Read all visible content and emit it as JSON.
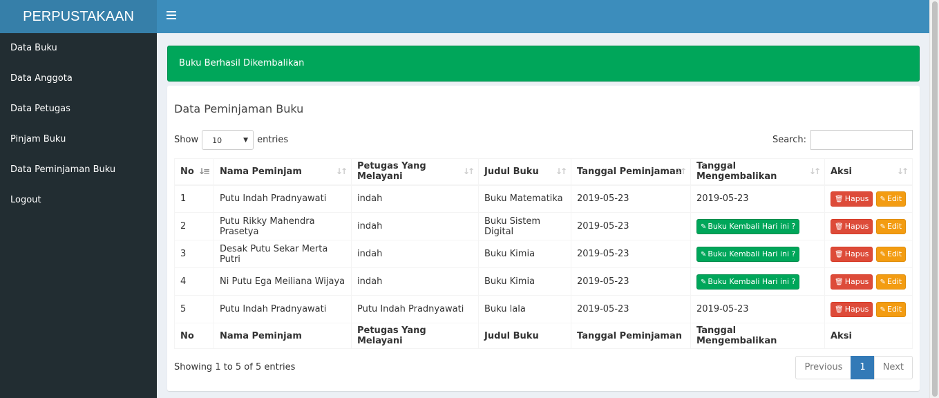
{
  "app": {
    "logo": "PERPUSTAKAAN"
  },
  "sidebar": {
    "items": [
      {
        "label": "Data Buku"
      },
      {
        "label": "Data Anggota"
      },
      {
        "label": "Data Petugas"
      },
      {
        "label": "Pinjam Buku"
      },
      {
        "label": "Data Peminjaman Buku"
      },
      {
        "label": "Logout"
      }
    ]
  },
  "alert": {
    "message": "Buku Berhasil Dikembalikan"
  },
  "main": {
    "title": "Data Peminjaman Buku",
    "length": {
      "show_label": "Show",
      "value": "10",
      "entries_label": "entries"
    },
    "search": {
      "label": "Search:",
      "value": ""
    },
    "columns": [
      "No",
      "Nama Peminjam",
      "Petugas Yang Melayani",
      "Judul Buku",
      "Tanggal Peminjaman",
      "Tanggal Mengembalikan",
      "Aksi"
    ],
    "rows": [
      {
        "no": "1",
        "nama": "Putu Indah Pradnyawati",
        "petugas": "indah",
        "judul": "Buku Matematika",
        "tgl_pinjam": "2019-05-23",
        "tgl_kembali": "2019-05-23"
      },
      {
        "no": "2",
        "nama": "Putu Rikky Mahendra Prasetya",
        "petugas": "indah",
        "judul": "Buku Sistem Digital",
        "tgl_pinjam": "2019-05-23",
        "tgl_kembali": ""
      },
      {
        "no": "3",
        "nama": "Desak Putu Sekar Merta Putri",
        "petugas": "indah",
        "judul": "Buku Kimia",
        "tgl_pinjam": "2019-05-23",
        "tgl_kembali": ""
      },
      {
        "no": "4",
        "nama": "Ni Putu Ega Meiliana Wijaya",
        "petugas": "indah",
        "judul": "Buku Kimia",
        "tgl_pinjam": "2019-05-23",
        "tgl_kembali": ""
      },
      {
        "no": "5",
        "nama": "Putu Indah Pradnyawati",
        "petugas": "Putu Indah Pradnyawati",
        "judul": "Buku lala",
        "tgl_pinjam": "2019-05-23",
        "tgl_kembali": "2019-05-23"
      }
    ],
    "buttons": {
      "kembali": "Buku Kembali Hari ini ?",
      "hapus": "Hapus",
      "edit": "Edit"
    },
    "icons": {
      "menu": "hamburger-icon",
      "sort": "sort-icon",
      "trash": "trash-icon",
      "pencil": "pencil-icon"
    },
    "info": "Showing 1 to 5 of 5 entries",
    "pagination": {
      "previous": "Previous",
      "current": "1",
      "next": "Next"
    }
  },
  "colors": {
    "header": "#3c8dbc",
    "logo": "#367fa9",
    "sidebar": "#222d32",
    "success": "#00a65a",
    "danger": "#dd4b39",
    "warning": "#f39c12",
    "primary": "#337ab7"
  }
}
